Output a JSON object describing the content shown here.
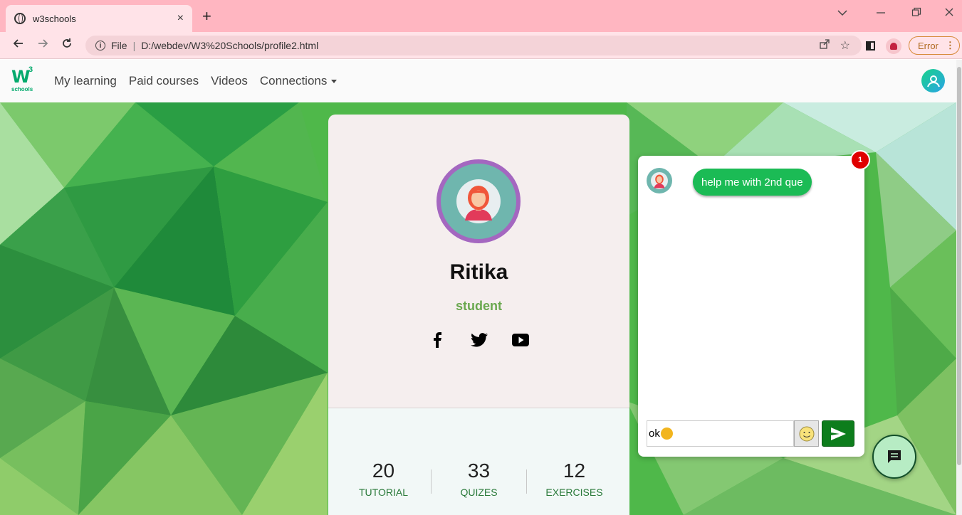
{
  "browser": {
    "tab_title": "w3schools",
    "tab_close": "×",
    "new_tab": "+",
    "url_scheme": "File",
    "url_path": "D:/webdev/W3%20Schools/profile2.html",
    "error_label": "Error"
  },
  "site": {
    "logo_letter": "W",
    "logo_sup": "3",
    "logo_sub": "schools",
    "nav": [
      "My learning",
      "Paid courses",
      "Videos",
      "Connections"
    ]
  },
  "profile": {
    "name": "Ritika",
    "role": "student",
    "socials": [
      "facebook-icon",
      "twitter-icon",
      "youtube-icon"
    ],
    "stats": [
      {
        "value": "20",
        "label": "TUTORIAL"
      },
      {
        "value": "33",
        "label": "QUIZES"
      },
      {
        "value": "12",
        "label": "EXERCISES"
      }
    ]
  },
  "chat": {
    "unread_count": "1",
    "message": "help me with 2nd que",
    "input_value": "ok"
  },
  "colors": {
    "tabbar": "#ffb6c1",
    "brand_green": "#04aa6d",
    "role_green": "#6aa84f",
    "bubble_green": "#1bbb55",
    "send_green": "#0d7d1c",
    "avatar_ring": "#a467c0"
  }
}
